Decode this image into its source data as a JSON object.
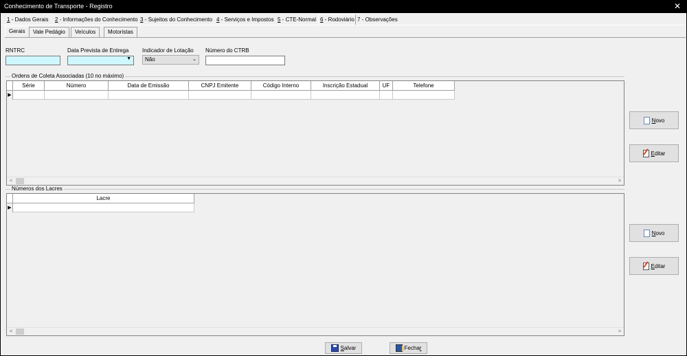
{
  "window": {
    "title": "Conhecimento de Transporte - Registro",
    "close_glyph": "✕"
  },
  "main_tabs": [
    {
      "key": "1",
      "label": " - Dados Gerais"
    },
    {
      "key": "2",
      "label": " - Informações do Conhecimento"
    },
    {
      "key": "3",
      "label": " - Sujeitos do Conhecimento"
    },
    {
      "key": "4",
      "label": " - Serviços e Impostos"
    },
    {
      "key": "5",
      "label": " - CTE-Normal"
    },
    {
      "key": "6",
      "label": " - Rodoviário"
    },
    {
      "key": "",
      "label": "7 - Observações"
    }
  ],
  "sub_tabs": [
    "Gerais",
    "Vale Pedágio",
    "Veículos",
    "Motoristas"
  ],
  "form": {
    "rntrc_label": "RNTRC",
    "rntrc_value": "",
    "data_prevista_label": "Data Prevista de Entrega",
    "data_prevista_value": "",
    "indicador_lotacao_label": "Indicador de Lotação",
    "indicador_lotacao_value": "Não",
    "numero_ctrb_label": "Número do CTRB",
    "numero_ctrb_value": ""
  },
  "ordens": {
    "group_label": "Ordens de Coleta Associadas (10 no máximo)",
    "columns": [
      "Série",
      "Número",
      "Data de Emissão",
      "CNPJ Emitente",
      "Código Interno",
      "Inscrição Estadual",
      "UF",
      "Telefone"
    ],
    "row_indicator": "▶"
  },
  "lacres": {
    "group_label": "Números dos Lacres",
    "columns": [
      "Lacre"
    ],
    "row_indicator": "▶"
  },
  "buttons": {
    "novo_prefix": "N",
    "novo_rest": "ovo",
    "editar_prefix": "E",
    "editar_rest": "ditar",
    "salvar_prefix": "S",
    "salvar_rest": "alvar",
    "fechar_prefix": "Fecha",
    "fechar_rest": "r"
  },
  "scroll": {
    "left_arrow": "<",
    "right_arrow": ">"
  },
  "colors": {
    "input_highlight": "#cff7ff",
    "titlebar": "#000000",
    "window_bg": "#f0f0f0"
  },
  "icons": [
    "close-icon",
    "new-document-icon",
    "edit-icon",
    "save-disk-icon",
    "exit-door-icon",
    "dropdown-arrow-icon",
    "row-indicator-icon"
  ]
}
